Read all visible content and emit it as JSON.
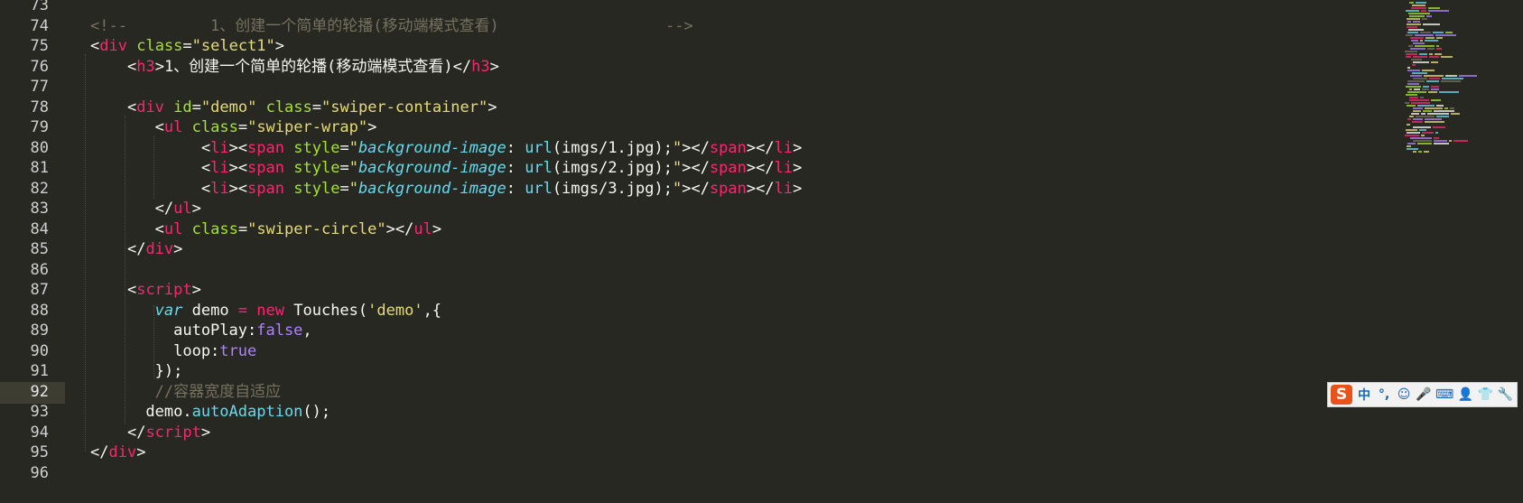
{
  "editor": {
    "theme_colors": {
      "background": "#272822",
      "tag": "#f92672",
      "attribute": "#a6e22e",
      "string": "#e6db74",
      "comment": "#75715e",
      "keyword": "#66d9ef",
      "constant": "#ae81ff",
      "text": "#f8f8f2"
    },
    "active_line": "92",
    "lines": [
      {
        "num": "73",
        "tokens": []
      },
      {
        "num": "74",
        "tokens": [
          {
            "c": "cmt",
            "t": "<!--         1、创建一个简单的轮播(移动端模式查看)                  -->"
          }
        ]
      },
      {
        "num": "75",
        "tokens": [
          {
            "c": "punc",
            "t": "<"
          },
          {
            "c": "tag",
            "t": "div"
          },
          {
            "c": "text",
            "t": " "
          },
          {
            "c": "attr",
            "t": "class"
          },
          {
            "c": "punc",
            "t": "="
          },
          {
            "c": "str",
            "t": "\"select1\""
          },
          {
            "c": "punc",
            "t": ">"
          }
        ]
      },
      {
        "num": "76",
        "tokens": [
          {
            "c": "text",
            "t": "    "
          },
          {
            "c": "punc",
            "t": "<"
          },
          {
            "c": "tag",
            "t": "h3"
          },
          {
            "c": "punc",
            "t": ">"
          },
          {
            "c": "text",
            "t": "1、创建一个简单的轮播(移动端模式查看)"
          },
          {
            "c": "punc",
            "t": "</"
          },
          {
            "c": "tag",
            "t": "h3"
          },
          {
            "c": "punc",
            "t": ">"
          }
        ]
      },
      {
        "num": "77",
        "tokens": []
      },
      {
        "num": "78",
        "tokens": [
          {
            "c": "text",
            "t": "    "
          },
          {
            "c": "punc",
            "t": "<"
          },
          {
            "c": "tag",
            "t": "div"
          },
          {
            "c": "text",
            "t": " "
          },
          {
            "c": "attr",
            "t": "id"
          },
          {
            "c": "punc",
            "t": "="
          },
          {
            "c": "str",
            "t": "\"demo\""
          },
          {
            "c": "text",
            "t": " "
          },
          {
            "c": "attr",
            "t": "class"
          },
          {
            "c": "punc",
            "t": "="
          },
          {
            "c": "str",
            "t": "\"swiper-container\""
          },
          {
            "c": "punc",
            "t": ">"
          }
        ]
      },
      {
        "num": "79",
        "tokens": [
          {
            "c": "text",
            "t": "       "
          },
          {
            "c": "punc",
            "t": "<"
          },
          {
            "c": "tag",
            "t": "ul"
          },
          {
            "c": "text",
            "t": " "
          },
          {
            "c": "attr",
            "t": "class"
          },
          {
            "c": "punc",
            "t": "="
          },
          {
            "c": "str",
            "t": "\"swiper-wrap\""
          },
          {
            "c": "punc",
            "t": ">"
          }
        ]
      },
      {
        "num": "80",
        "tokens": [
          {
            "c": "text",
            "t": "            "
          },
          {
            "c": "punc",
            "t": "<"
          },
          {
            "c": "tag",
            "t": "li"
          },
          {
            "c": "punc",
            "t": "><"
          },
          {
            "c": "tag",
            "t": "span"
          },
          {
            "c": "text",
            "t": " "
          },
          {
            "c": "attr",
            "t": "style"
          },
          {
            "c": "punc",
            "t": "="
          },
          {
            "c": "str",
            "t": "\""
          },
          {
            "c": "prop",
            "t": "background-image"
          },
          {
            "c": "text",
            "t": ": "
          },
          {
            "c": "fn",
            "t": "url"
          },
          {
            "c": "text",
            "t": "(imgs/1.jpg);"
          },
          {
            "c": "str",
            "t": "\""
          },
          {
            "c": "punc",
            "t": "></"
          },
          {
            "c": "tag",
            "t": "span"
          },
          {
            "c": "punc",
            "t": "></"
          },
          {
            "c": "tag",
            "t": "li"
          },
          {
            "c": "punc",
            "t": ">"
          }
        ]
      },
      {
        "num": "81",
        "tokens": [
          {
            "c": "text",
            "t": "            "
          },
          {
            "c": "punc",
            "t": "<"
          },
          {
            "c": "tag",
            "t": "li"
          },
          {
            "c": "punc",
            "t": "><"
          },
          {
            "c": "tag",
            "t": "span"
          },
          {
            "c": "text",
            "t": " "
          },
          {
            "c": "attr",
            "t": "style"
          },
          {
            "c": "punc",
            "t": "="
          },
          {
            "c": "str",
            "t": "\""
          },
          {
            "c": "prop",
            "t": "background-image"
          },
          {
            "c": "text",
            "t": ": "
          },
          {
            "c": "fn",
            "t": "url"
          },
          {
            "c": "text",
            "t": "(imgs/2.jpg);"
          },
          {
            "c": "str",
            "t": "\""
          },
          {
            "c": "punc",
            "t": "></"
          },
          {
            "c": "tag",
            "t": "span"
          },
          {
            "c": "punc",
            "t": "></"
          },
          {
            "c": "tag",
            "t": "li"
          },
          {
            "c": "punc",
            "t": ">"
          }
        ]
      },
      {
        "num": "82",
        "tokens": [
          {
            "c": "text",
            "t": "            "
          },
          {
            "c": "punc",
            "t": "<"
          },
          {
            "c": "tag",
            "t": "li"
          },
          {
            "c": "punc",
            "t": "><"
          },
          {
            "c": "tag",
            "t": "span"
          },
          {
            "c": "text",
            "t": " "
          },
          {
            "c": "attr",
            "t": "style"
          },
          {
            "c": "punc",
            "t": "="
          },
          {
            "c": "str",
            "t": "\""
          },
          {
            "c": "prop",
            "t": "background-image"
          },
          {
            "c": "text",
            "t": ": "
          },
          {
            "c": "fn",
            "t": "url"
          },
          {
            "c": "text",
            "t": "(imgs/3.jpg);"
          },
          {
            "c": "str",
            "t": "\""
          },
          {
            "c": "punc",
            "t": "></"
          },
          {
            "c": "tag",
            "t": "span"
          },
          {
            "c": "punc",
            "t": "></"
          },
          {
            "c": "tag",
            "t": "li"
          },
          {
            "c": "punc",
            "t": ">"
          }
        ]
      },
      {
        "num": "83",
        "tokens": [
          {
            "c": "text",
            "t": "       "
          },
          {
            "c": "punc",
            "t": "</"
          },
          {
            "c": "tag",
            "t": "ul"
          },
          {
            "c": "punc",
            "t": ">"
          }
        ]
      },
      {
        "num": "84",
        "tokens": [
          {
            "c": "text",
            "t": "       "
          },
          {
            "c": "punc",
            "t": "<"
          },
          {
            "c": "tag",
            "t": "ul"
          },
          {
            "c": "text",
            "t": " "
          },
          {
            "c": "attr",
            "t": "class"
          },
          {
            "c": "punc",
            "t": "="
          },
          {
            "c": "str",
            "t": "\"swiper-circle\""
          },
          {
            "c": "punc",
            "t": "></"
          },
          {
            "c": "tag",
            "t": "ul"
          },
          {
            "c": "punc",
            "t": ">"
          }
        ]
      },
      {
        "num": "85",
        "tokens": [
          {
            "c": "text",
            "t": "    "
          },
          {
            "c": "punc",
            "t": "</"
          },
          {
            "c": "tag",
            "t": "div"
          },
          {
            "c": "punc",
            "t": ">"
          }
        ]
      },
      {
        "num": "86",
        "tokens": []
      },
      {
        "num": "87",
        "tokens": [
          {
            "c": "text",
            "t": "    "
          },
          {
            "c": "punc",
            "t": "<"
          },
          {
            "c": "tag",
            "t": "script"
          },
          {
            "c": "punc",
            "t": ">"
          }
        ]
      },
      {
        "num": "88",
        "tokens": [
          {
            "c": "text",
            "t": "       "
          },
          {
            "c": "kw",
            "t": "var"
          },
          {
            "c": "text",
            "t": " demo "
          },
          {
            "c": "op",
            "t": "="
          },
          {
            "c": "text",
            "t": " "
          },
          {
            "c": "op",
            "t": "new"
          },
          {
            "c": "text",
            "t": " Touches("
          },
          {
            "c": "str",
            "t": "'demo'"
          },
          {
            "c": "text",
            "t": ",{"
          }
        ]
      },
      {
        "num": "89",
        "tokens": [
          {
            "c": "text",
            "t": "         autoPlay:"
          },
          {
            "c": "bool",
            "t": "false"
          },
          {
            "c": "text",
            "t": ","
          }
        ]
      },
      {
        "num": "90",
        "tokens": [
          {
            "c": "text",
            "t": "         loop:"
          },
          {
            "c": "bool",
            "t": "true"
          }
        ]
      },
      {
        "num": "91",
        "tokens": [
          {
            "c": "text",
            "t": "       });"
          }
        ]
      },
      {
        "num": "92",
        "tokens": [
          {
            "c": "text",
            "t": "       "
          },
          {
            "c": "cmt",
            "t": "//容器宽度自适应"
          }
        ]
      },
      {
        "num": "93",
        "tokens": [
          {
            "c": "text",
            "t": "      demo."
          },
          {
            "c": "fn",
            "t": "autoAdaption"
          },
          {
            "c": "text",
            "t": "();"
          }
        ]
      },
      {
        "num": "94",
        "tokens": [
          {
            "c": "text",
            "t": "    "
          },
          {
            "c": "punc",
            "t": "</"
          },
          {
            "c": "tag",
            "t": "script"
          },
          {
            "c": "punc",
            "t": ">"
          }
        ]
      },
      {
        "num": "95",
        "tokens": [
          {
            "c": "punc",
            "t": "</"
          },
          {
            "c": "tag",
            "t": "div"
          },
          {
            "c": "punc",
            "t": ">"
          }
        ]
      },
      {
        "num": "96",
        "tokens": []
      }
    ]
  },
  "ime_toolbar": {
    "logo": "S",
    "items": [
      {
        "name": "ime-mode-chinese",
        "label": "中",
        "icon": ""
      },
      {
        "name": "ime-punctuation",
        "label": "°,",
        "icon": ""
      },
      {
        "name": "ime-emoji-button",
        "label": "☺",
        "icon": "smiley-icon"
      },
      {
        "name": "ime-voice-button",
        "label": "🎤",
        "icon": "microphone-icon"
      },
      {
        "name": "ime-keyboard-button",
        "label": "⌨",
        "icon": "keyboard-icon"
      },
      {
        "name": "ime-user-button",
        "label": "👤",
        "icon": "user-icon"
      },
      {
        "name": "ime-skin-button",
        "label": "👕",
        "icon": "shirt-icon"
      },
      {
        "name": "ime-settings-button",
        "label": "🔧",
        "icon": "wrench-icon"
      }
    ]
  }
}
